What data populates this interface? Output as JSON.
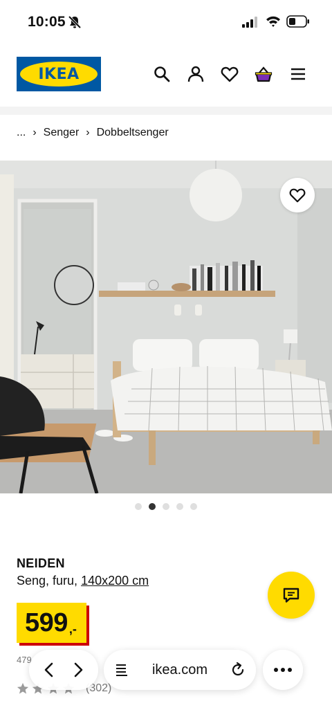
{
  "status_bar": {
    "time": "10:05",
    "icons": [
      "bell-slash-icon",
      "signal-icon",
      "wifi-icon",
      "battery-icon"
    ]
  },
  "header": {
    "logo_text": "IKEA",
    "icons": [
      "search-icon",
      "user-icon",
      "heart-icon",
      "basket-icon",
      "menu-icon"
    ]
  },
  "breadcrumb": {
    "items": [
      "...",
      "Senger",
      "Dobbeltsenger"
    ],
    "separator": "›"
  },
  "gallery": {
    "image_count": 5,
    "active_index": 1
  },
  "product": {
    "name": "NEIDEN",
    "description_prefix": "Seng, furu, ",
    "size": "140x200 cm",
    "price": "599",
    "price_suffix": ",-",
    "sub_text": "479",
    "rating_stars": 4,
    "rating_count": "(302)"
  },
  "browser": {
    "url": "ikea.com"
  },
  "colors": {
    "ikea_blue": "#0058a3",
    "ikea_yellow": "#ffdb00",
    "price_shadow_red": "#cc0008"
  }
}
